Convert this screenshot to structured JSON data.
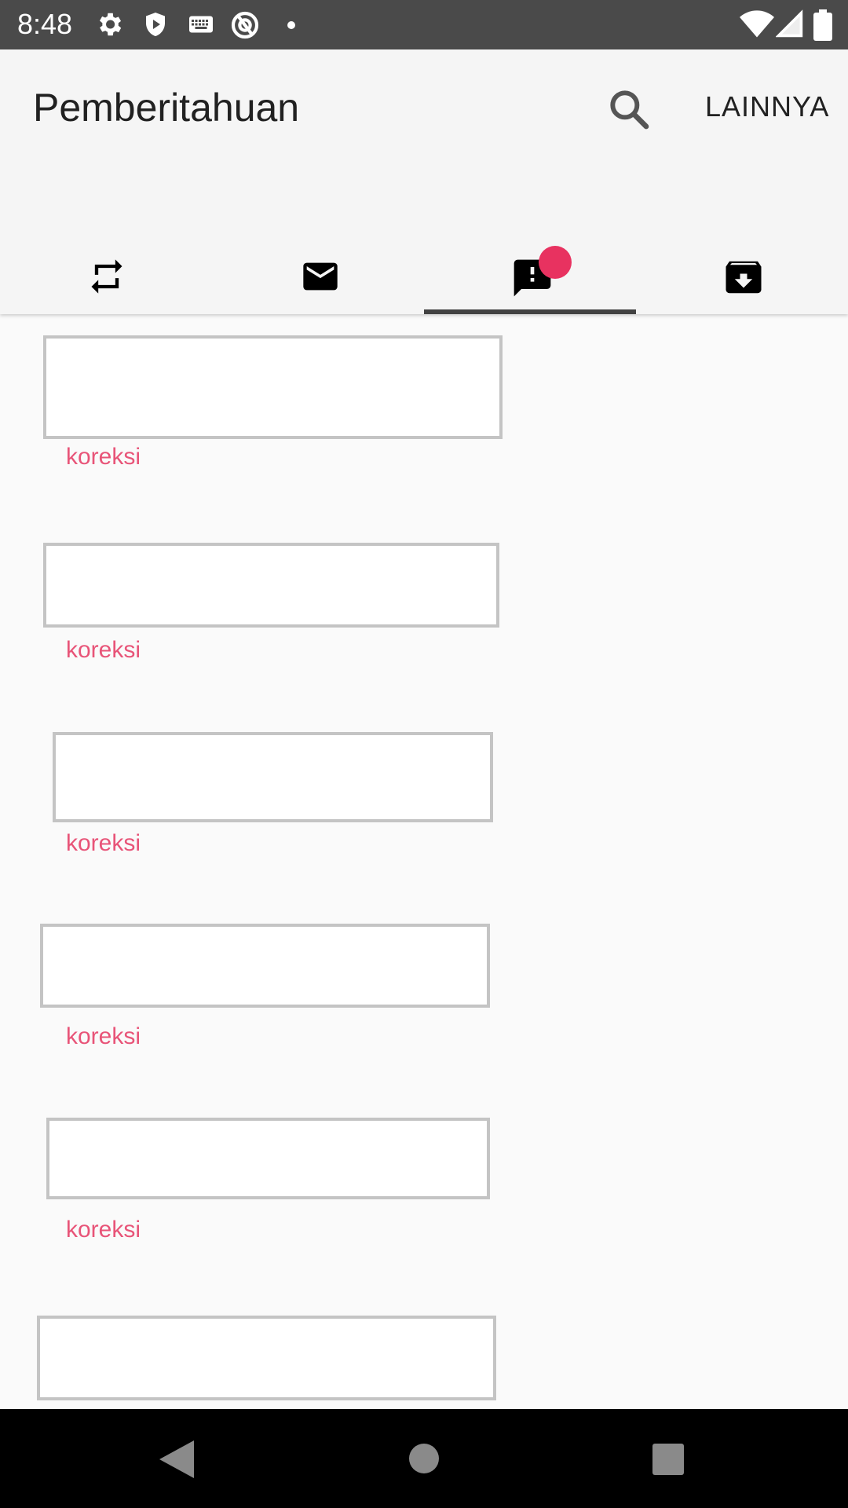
{
  "status_bar": {
    "time": "8:48",
    "icons": [
      "gear-icon",
      "shield-play-icon",
      "keyboard-icon",
      "no-disturb-icon",
      "dot-icon",
      "wifi-icon",
      "signal-icon",
      "battery-icon"
    ]
  },
  "app_bar": {
    "title": "Pemberitahuan",
    "search_icon": "search-icon",
    "more_label": "LAINNYA"
  },
  "tabs": [
    {
      "icon": "repeat-icon",
      "selected": false
    },
    {
      "icon": "mail-icon",
      "selected": false
    },
    {
      "icon": "feedback-icon",
      "selected": true,
      "badge": true
    },
    {
      "icon": "archive-download-icon",
      "selected": false
    }
  ],
  "items": [
    {
      "link": "koreksi"
    },
    {
      "link": "koreksi"
    },
    {
      "link": "koreksi"
    },
    {
      "link": "koreksi"
    },
    {
      "link": "koreksi"
    },
    {
      "link": ""
    }
  ],
  "nav_bar": {
    "icons": [
      "back-icon",
      "home-icon",
      "recents-icon"
    ]
  },
  "colors": {
    "accent": "#e83260",
    "link": "#e85478",
    "status_bar": "#4a4a4a",
    "app_bar": "#f5f5f5"
  }
}
